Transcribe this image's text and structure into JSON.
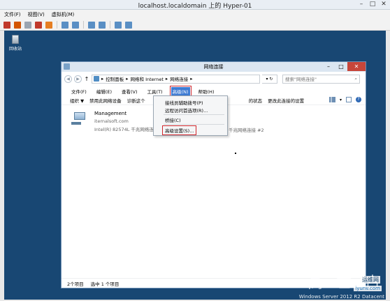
{
  "vm": {
    "title": "localhost.localdomain 上的 Hyper-01",
    "menu": [
      "文件(F)",
      "视图(V)",
      "虚拟机(M)"
    ],
    "toolbar_icons": [
      {
        "name": "ctrl-alt-del-icon",
        "color": "#c0392b"
      },
      {
        "name": "stop-icon",
        "color": "#d35400"
      },
      {
        "name": "play-icon",
        "color": "#9aa5b1"
      },
      {
        "name": "power-icon",
        "color": "#c0392b"
      },
      {
        "name": "pause-icon",
        "color": "#e67e22"
      },
      {
        "name": "sep",
        "color": ""
      },
      {
        "name": "checkpoint-icon",
        "color": "#5a8fc4"
      },
      {
        "name": "revert-icon",
        "color": "#5a8fc4"
      },
      {
        "name": "sep",
        "color": ""
      },
      {
        "name": "insert-disk-icon",
        "color": "#5a8fc4"
      },
      {
        "name": "mouse-release-icon",
        "color": "#5a8fc4"
      },
      {
        "name": "sep",
        "color": ""
      },
      {
        "name": "settings-icon",
        "color": "#5a8fc4"
      },
      {
        "name": "type-clipboard-icon",
        "color": "#5a8fc4"
      }
    ]
  },
  "desktop": {
    "recycle_bin": "回收站",
    "watermark": {
      "logo": "高  亡  古",
      "brand": "运维网",
      "site": "iyunv.com",
      "os": "Windows Server 2012 R2 Datacent"
    }
  },
  "explorer": {
    "title": "网络连接",
    "breadcrumb": [
      "控制面板",
      "网络和 Internet",
      "网络连接"
    ],
    "search_placeholder": "搜索\"网络连接\"",
    "menu": [
      "文件(F)",
      "编辑(E)",
      "查看(V)",
      "工具(T)",
      "高级(N)",
      "帮助(H)"
    ],
    "command_bar": [
      "组织 ▼",
      "禁用此网络设备",
      "诊断这个",
      "的状态",
      "更改此连接的设置"
    ],
    "connection": {
      "name": "Management",
      "domain": "iternalsoft.com",
      "adapter": "Intel(R) 82574L 千兆网络连",
      "adapter2": "千兆网络连接 #2"
    },
    "advanced_menu": [
      "接线员辅助拨号(P)",
      "远程访问首选项(R)...",
      "桥接(C)",
      "高级设置(S)..."
    ],
    "status": {
      "items": "2个项目",
      "selected": "选中 1 个项目"
    }
  }
}
